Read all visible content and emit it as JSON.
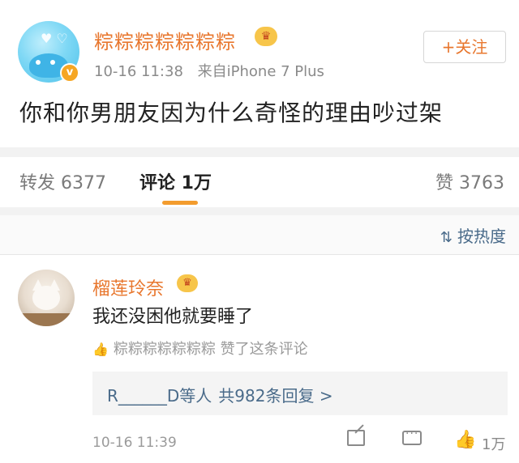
{
  "post": {
    "username": "粽粽粽粽粽粽粽",
    "time": "10-16 11:38",
    "source": "来自iPhone 7 Plus",
    "follow_label": "+关注",
    "text": "你和你男朋友因为什么奇怪的理由吵过架"
  },
  "tabs": {
    "repost": "转发 6377",
    "comment": "评论 1万",
    "like": "赞 3763"
  },
  "sort": {
    "label": "按热度"
  },
  "comment": {
    "name": "榴莲玲奈",
    "text": "我还没困他就要睡了",
    "liked_by": "粽粽粽粽粽粽粽 赞了这条评论",
    "reply_user": "R______D等人",
    "reply_count": "共982条回复 >",
    "time": "10-16 11:39",
    "like_count": "1万"
  },
  "colors": {
    "accent": "#e8772e",
    "link": "#4a6b8a",
    "tab_underline": "#f39c2e"
  },
  "icons": [
    "vip-crown-icon",
    "verified-v-icon",
    "sort-icon",
    "thumb-up-icon",
    "share-icon",
    "reply-bubble-icon"
  ]
}
